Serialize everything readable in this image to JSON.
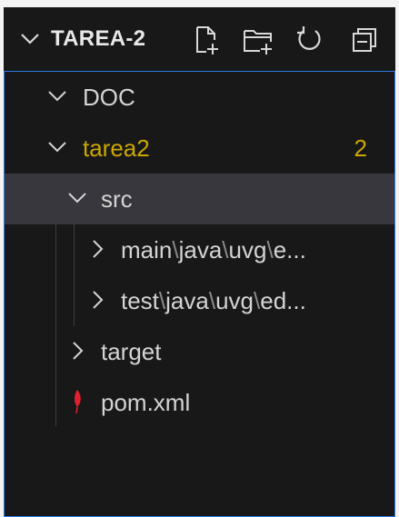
{
  "explorer": {
    "title": "TAREA-2",
    "icons": [
      "new-file-icon",
      "new-folder-icon",
      "refresh-icon",
      "collapse-all-icon"
    ]
  },
  "tree": {
    "doc": {
      "label": "DOC",
      "icon": "chevron-down-icon"
    },
    "tarea2": {
      "label": "tarea2",
      "badge": "2",
      "icon": "chevron-down-icon",
      "color": "#cca700"
    },
    "src": {
      "label": "src",
      "icon": "chevron-down-icon"
    },
    "main": {
      "parts": [
        "main",
        "\\",
        "java",
        "\\",
        "uvg",
        "\\",
        "e..."
      ],
      "icon": "chevron-right-icon"
    },
    "test": {
      "parts": [
        "test",
        "\\",
        "java",
        "\\",
        "uvg",
        "\\",
        "ed..."
      ],
      "icon": "chevron-right-icon"
    },
    "target": {
      "label": "target",
      "icon": "chevron-right-icon"
    },
    "pom": {
      "label": "pom.xml",
      "icon": "maven-icon",
      "icon_color": "#e0202e"
    }
  }
}
